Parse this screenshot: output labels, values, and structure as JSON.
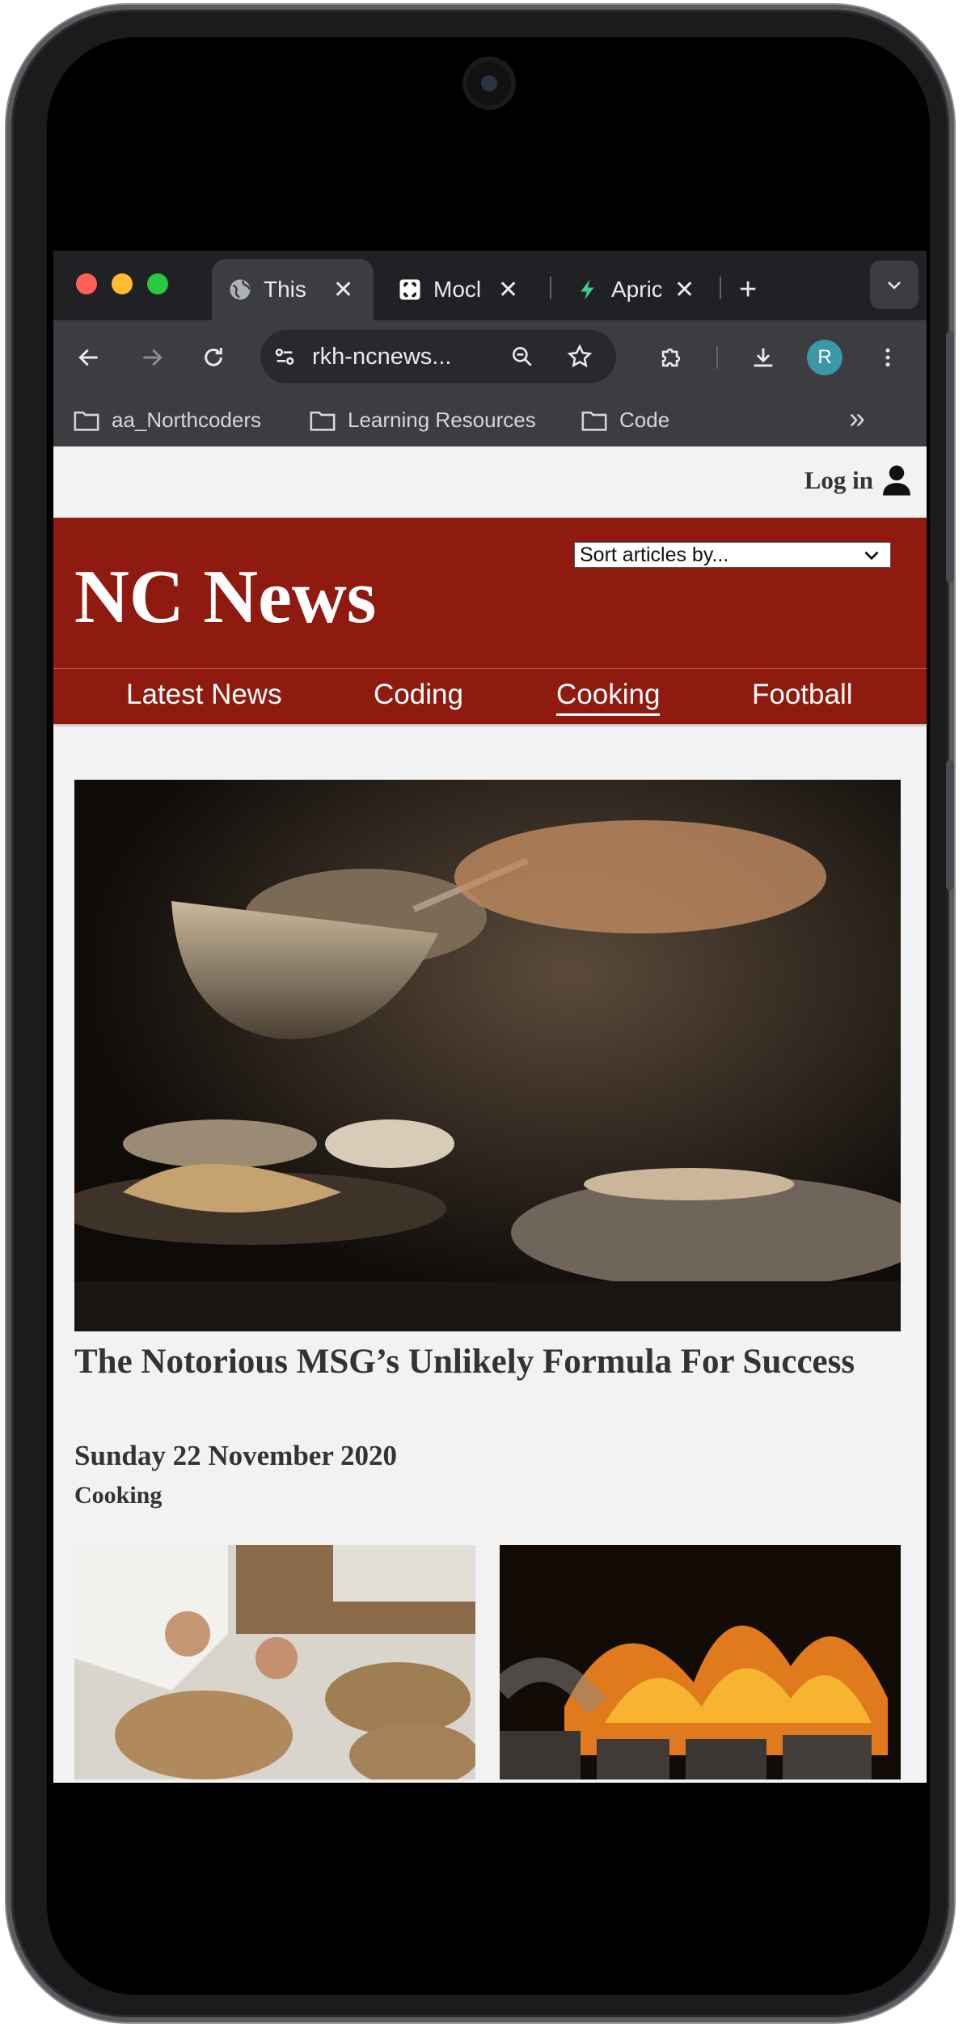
{
  "browser": {
    "tabs": [
      {
        "title": "This",
        "favicon": "globe-icon",
        "active": true
      },
      {
        "title": "Mocl",
        "favicon": "mockaroo-icon",
        "active": false
      },
      {
        "title": "Apric",
        "favicon": "bolt-icon",
        "active": false
      }
    ],
    "close_glyph": "✕",
    "new_tab_glyph": "+",
    "url": "rkh-ncnews...",
    "profile_initial": "R",
    "bookmarks": [
      "aa_Northcoders",
      "Learning Resources",
      "Code"
    ],
    "bookmarks_overflow": "»"
  },
  "site": {
    "login_label": "Log in",
    "brand": "NC News",
    "sort_placeholder": "Sort articles by...",
    "nav": [
      {
        "label": "Latest News",
        "current": false
      },
      {
        "label": "Coding",
        "current": false
      },
      {
        "label": "Cooking",
        "current": true
      },
      {
        "label": "Football",
        "current": false
      }
    ],
    "featured": {
      "title": "The Notorious MSG’s Unlikely Formula For Success",
      "date": "Sunday 22 November 2020",
      "topic": "Cooking"
    }
  },
  "colors": {
    "brand_red": "#8f1a10",
    "page_bg": "#f2f2f2",
    "chrome_dark": "#202124",
    "chrome_toolbar": "#3c3d41",
    "profile_teal": "#3d97a9"
  }
}
